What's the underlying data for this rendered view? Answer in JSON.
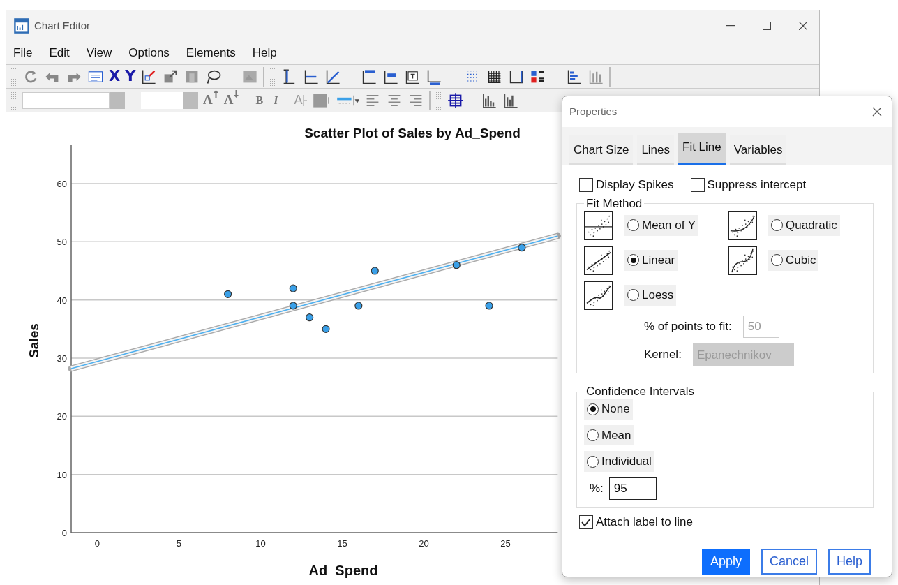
{
  "window": {
    "title": "Chart Editor"
  },
  "menu": [
    "File",
    "Edit",
    "View",
    "Options",
    "Elements",
    "Help"
  ],
  "toolbar": {
    "x_button": "X",
    "y_button": "Y",
    "grow_font": "A",
    "shrink_font": "A",
    "bold": "B",
    "italic": "I",
    "text_color": "A"
  },
  "chart": {
    "chart_data": {
      "type": "scatter",
      "title": "Scatter Plot of Sales by Ad_Spend",
      "xlabel": "Ad_Spend",
      "ylabel": "Sales",
      "x": [
        8,
        12,
        12,
        13,
        14,
        16,
        17,
        22,
        24,
        26
      ],
      "series": [
        {
          "color": "#3aa0e8",
          "values": [
            41,
            42,
            39,
            37,
            35,
            39,
            45,
            46,
            39,
            49
          ]
        },
        {
          "type": "line",
          "color": "#4db0f0",
          "x": [
            -1.6,
            28.2
          ],
          "values": [
            28.2,
            51
          ]
        }
      ],
      "xticks": [
        0,
        5,
        10,
        15,
        20,
        25
      ],
      "yticks": [
        0,
        10,
        20,
        30,
        40,
        50,
        60
      ],
      "xlim": [
        -1.6,
        28.2
      ],
      "ylim": [
        0,
        66.6
      ],
      "grid": true
    }
  },
  "properties": {
    "title": "Properties",
    "tabs": [
      {
        "label": "Chart Size",
        "selected": false
      },
      {
        "label": "Lines",
        "selected": false
      },
      {
        "label": "Fit Line",
        "selected": true
      },
      {
        "label": "Variables",
        "selected": false
      }
    ],
    "checks": [
      {
        "label": "Display Spikes",
        "checked": false
      },
      {
        "label": "Suppress intercept",
        "checked": false
      }
    ],
    "fit_method": {
      "title": "Fit Method",
      "options": [
        {
          "label": "Mean of Y",
          "kind": "mean",
          "selected": false
        },
        {
          "label": "Quadratic",
          "kind": "quadratic",
          "selected": false
        },
        {
          "label": "Linear",
          "kind": "linear",
          "selected": true
        },
        {
          "label": "Cubic",
          "kind": "cubic",
          "selected": false
        },
        {
          "label": "Loess",
          "kind": "loess",
          "selected": false
        }
      ],
      "points_label": "% of points to fit:",
      "points_value": "50",
      "points_disabled": true,
      "kernel_label": "Kernel:",
      "kernel_value": "Epanechnikov",
      "kernel_disabled": true
    },
    "confidence": {
      "title": "Confidence Intervals",
      "options": [
        {
          "label": "None",
          "selected": true
        },
        {
          "label": "Mean",
          "selected": false
        },
        {
          "label": "Individual",
          "selected": false
        }
      ],
      "percent_label": "%:",
      "percent_value": "95"
    },
    "attach": {
      "label": "Attach label to line",
      "checked": true
    },
    "buttons": [
      {
        "label": "Apply",
        "kind": "primary"
      },
      {
        "label": "Cancel",
        "kind": "secondary"
      },
      {
        "label": "Help",
        "kind": "secondary"
      }
    ]
  }
}
